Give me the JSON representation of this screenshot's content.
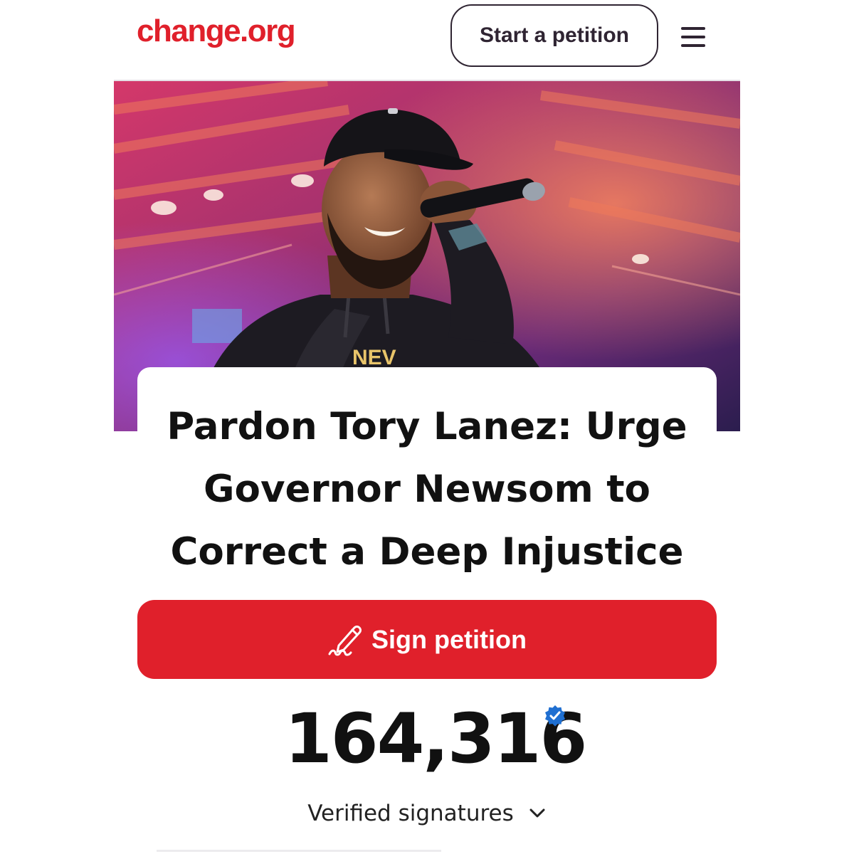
{
  "header": {
    "logo": "change.org",
    "start_button": "Start a petition",
    "menu_icon": "hamburger-menu-icon"
  },
  "hero": {
    "image_subject": "performer singing into microphone on stage"
  },
  "petition": {
    "title": "Pardon Tory Lanez: Urge Governor Newsom to Correct a Deep Injustice",
    "sign_button": "Sign petition",
    "sign_icon": "pen-signature-icon"
  },
  "signatures": {
    "count": "164,316",
    "label": "Verified signatures",
    "badge_icon": "verified-badge-icon",
    "expand_icon": "chevron-down-icon"
  },
  "colors": {
    "brand": "#e0202b",
    "text": "#111111",
    "outline": "#2f2432",
    "verified": "#1f6fd1"
  }
}
